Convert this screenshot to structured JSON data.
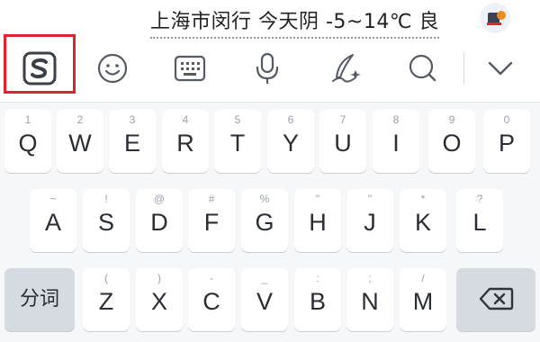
{
  "status": {
    "weather_text": "上海市闵行 今天阴 -5~14℃ 良"
  },
  "toolbar": {
    "items": [
      {
        "name": "sogou-logo-icon"
      },
      {
        "name": "emoji-icon"
      },
      {
        "name": "keyboard-icon"
      },
      {
        "name": "microphone-icon"
      },
      {
        "name": "handwriting-icon"
      },
      {
        "name": "search-icon"
      },
      {
        "name": "collapse-chevron-icon"
      }
    ],
    "highlight_color": "#e0242b"
  },
  "keyboard": {
    "row1": [
      {
        "hint": "1",
        "label": "Q"
      },
      {
        "hint": "2",
        "label": "W"
      },
      {
        "hint": "3",
        "label": "E"
      },
      {
        "hint": "4",
        "label": "R"
      },
      {
        "hint": "5",
        "label": "T"
      },
      {
        "hint": "6",
        "label": "Y"
      },
      {
        "hint": "7",
        "label": "U"
      },
      {
        "hint": "8",
        "label": "I"
      },
      {
        "hint": "9",
        "label": "O"
      },
      {
        "hint": "0",
        "label": "P"
      }
    ],
    "row2": [
      {
        "hint": "~",
        "label": "A"
      },
      {
        "hint": "!",
        "label": "S"
      },
      {
        "hint": "@",
        "label": "D"
      },
      {
        "hint": "#",
        "label": "F"
      },
      {
        "hint": "%",
        "label": "G"
      },
      {
        "hint": "\"",
        "label": "H"
      },
      {
        "hint": "\"",
        "label": "J"
      },
      {
        "hint": "*",
        "label": "K"
      },
      {
        "hint": "?",
        "label": "L"
      }
    ],
    "row3": [
      {
        "hint": "(",
        "label": "Z"
      },
      {
        "hint": ")",
        "label": "X"
      },
      {
        "hint": "-",
        "label": "C"
      },
      {
        "hint": "_",
        "label": "V"
      },
      {
        "hint": ":",
        "label": "B"
      },
      {
        "hint": ";",
        "label": "N"
      },
      {
        "hint": "/",
        "label": "M"
      }
    ],
    "segment_label": "分词",
    "backspace_icon": "backspace-icon"
  }
}
